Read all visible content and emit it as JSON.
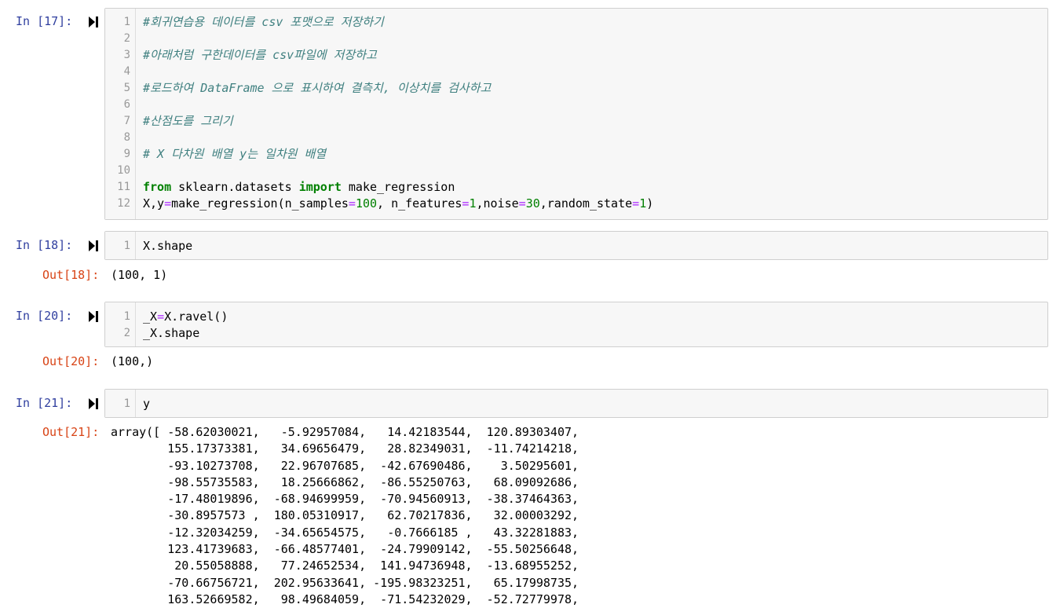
{
  "cells": [
    {
      "in_prompt": "In [17]:",
      "lines": [
        [
          {
            "t": "cm",
            "v": "#회귀연습용 데이터를 csv 포맷으로 저장하기"
          }
        ],
        [],
        [
          {
            "t": "cm",
            "v": "#아래처럼 구한데이터를 csv파일에 저장하고"
          }
        ],
        [],
        [
          {
            "t": "cm",
            "v": "#로드하여 DataFrame 으로 표시하여 결측치, 이상치를 검사하고"
          }
        ],
        [],
        [
          {
            "t": "cm",
            "v": "#산점도를 그리기"
          }
        ],
        [],
        [
          {
            "t": "cm",
            "v": "# X 다차원 배열 y는 일차원 배열"
          }
        ],
        [],
        [
          {
            "t": "kw",
            "v": "from"
          },
          {
            "t": "p",
            "v": " sklearn.datasets "
          },
          {
            "t": "kw",
            "v": "import"
          },
          {
            "t": "p",
            "v": " make_regression"
          }
        ],
        [
          {
            "t": "p",
            "v": "X,y"
          },
          {
            "t": "op",
            "v": "="
          },
          {
            "t": "p",
            "v": "make_regression(n_samples"
          },
          {
            "t": "op",
            "v": "="
          },
          {
            "t": "num",
            "v": "100"
          },
          {
            "t": "p",
            "v": ", n_features"
          },
          {
            "t": "op",
            "v": "="
          },
          {
            "t": "num",
            "v": "1"
          },
          {
            "t": "p",
            "v": ",noise"
          },
          {
            "t": "op",
            "v": "="
          },
          {
            "t": "num",
            "v": "30"
          },
          {
            "t": "p",
            "v": ",random_state"
          },
          {
            "t": "op",
            "v": "="
          },
          {
            "t": "num",
            "v": "1"
          },
          {
            "t": "p",
            "v": ")"
          }
        ]
      ]
    },
    {
      "in_prompt": "In [18]:",
      "lines": [
        [
          {
            "t": "p",
            "v": "X.shape"
          }
        ]
      ],
      "out_prompt": "Out[18]:",
      "output": [
        "(100, 1)"
      ]
    },
    {
      "in_prompt": "In [20]:",
      "lines": [
        [
          {
            "t": "p",
            "v": "_X"
          },
          {
            "t": "op",
            "v": "="
          },
          {
            "t": "p",
            "v": "X.ravel()"
          }
        ],
        [
          {
            "t": "p",
            "v": "_X.shape"
          }
        ]
      ],
      "out_prompt": "Out[20]:",
      "output": [
        "(100,)"
      ]
    },
    {
      "in_prompt": "In [21]:",
      "lines": [
        [
          {
            "t": "p",
            "v": "y"
          }
        ]
      ],
      "out_prompt": "Out[21]:",
      "output": [
        "array([ -58.62030021,   -5.92957084,   14.42183544,  120.89303407,",
        "        155.17373381,   34.69656479,   28.82349031,  -11.74214218,",
        "        -93.10273708,   22.96707685,  -42.67690486,    3.50295601,",
        "        -98.55735583,   18.25666862,  -86.55250763,   68.09092686,",
        "        -17.48019896,  -68.94699959,  -70.94560913,  -38.37464363,",
        "        -30.8957573 ,  180.05310917,   62.70217836,   32.00003292,",
        "        -12.32034259,  -34.65654575,   -0.7666185 ,   43.32281883,",
        "        123.41739683,  -66.48577401,  -24.79909142,  -55.50256648,",
        "         20.55058888,   77.24652534,  141.94736948,  -13.68955252,",
        "        -70.66756721,  202.95633641, -195.98323251,   65.17998735,",
        "        163.52669582,   98.49684059,  -71.54232029,  -52.72779978,"
      ]
    }
  ]
}
